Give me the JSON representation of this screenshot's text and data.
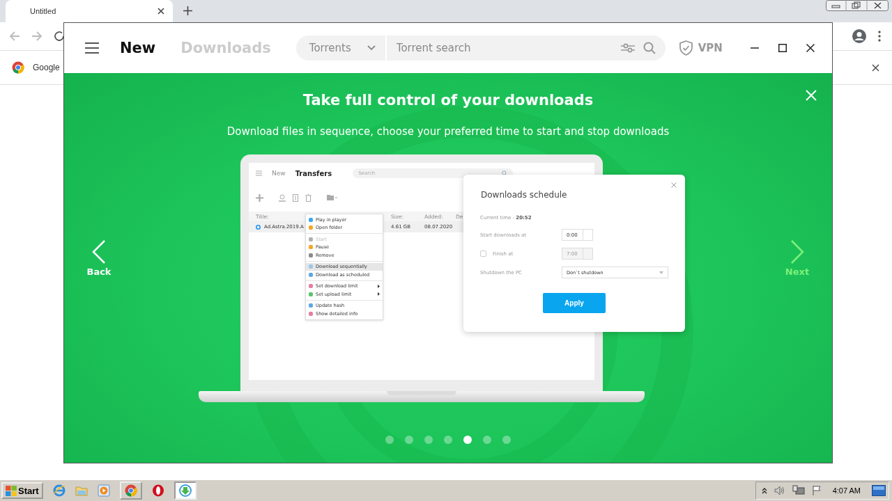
{
  "browser": {
    "tab_title": "Untitled",
    "bookmark": "Google"
  },
  "app": {
    "nav": [
      {
        "label": "New",
        "selected": true
      },
      {
        "label": "Downloads",
        "selected": false
      }
    ],
    "category": "Torrents",
    "search": {
      "placeholder": "Torrent search"
    },
    "vpn": "VPN"
  },
  "tour": {
    "title": "Take full control of your downloads",
    "subtitle": "Download files in sequence, choose your preferred time to start and stop downloads",
    "back": "Back",
    "next": "Next",
    "slides": [
      {
        "selected": false
      },
      {
        "selected": false
      },
      {
        "selected": false
      },
      {
        "selected": false
      },
      {
        "selected": true
      },
      {
        "selected": false
      },
      {
        "selected": false
      }
    ]
  },
  "preview": {
    "nav": [
      {
        "label": "New",
        "selected": false
      },
      {
        "label": "Transfers",
        "selected": true
      }
    ],
    "search": {
      "placeholder": "Search"
    },
    "columns": [
      "Title:",
      "Size:",
      "Added:",
      "De"
    ],
    "row": {
      "title": "Ad.Astra.2019.A",
      "size": "4.61 GB",
      "added": "08.07.2020"
    },
    "menu": [
      [
        {
          "label": "Play in player",
          "color": "#3ba7e8",
          "disabled": false,
          "selected": false,
          "submenu": false
        },
        {
          "label": "Open folder",
          "color": "#f5a623",
          "disabled": false,
          "selected": false,
          "submenu": false
        }
      ],
      [
        {
          "label": "Start",
          "color": "#b0b0b0",
          "disabled": true,
          "selected": false,
          "submenu": false
        },
        {
          "label": "Pause",
          "color": "#f5a623",
          "disabled": false,
          "selected": false,
          "submenu": false
        },
        {
          "label": "Remove",
          "color": "#8a8a8a",
          "disabled": false,
          "selected": false,
          "submenu": false
        }
      ],
      [
        {
          "label": "Download sequentially",
          "color": "#9cc7e8",
          "disabled": false,
          "selected": true,
          "submenu": false
        },
        {
          "label": "Download as scheduled",
          "color": "#5aa9e6",
          "disabled": false,
          "selected": false,
          "submenu": false
        }
      ],
      [
        {
          "label": "Set download limit",
          "color": "#e57ea0",
          "disabled": false,
          "selected": false,
          "submenu": true
        },
        {
          "label": "Set upload limit",
          "color": "#5cc46a",
          "disabled": false,
          "selected": false,
          "submenu": true
        }
      ],
      [
        {
          "label": "Update hash",
          "color": "#5aa9e6",
          "disabled": false,
          "selected": false,
          "submenu": false
        },
        {
          "label": "Show detailed info",
          "color": "#e57ea0",
          "disabled": false,
          "selected": false,
          "submenu": false
        }
      ]
    ]
  },
  "schedule": {
    "title": "Downloads schedule",
    "current_time": "Current time - **20:52**",
    "start_label": "Start downloads at",
    "start_value": "0:00",
    "finish": {
      "label": "Finish at",
      "checked": false,
      "value": "7:00"
    },
    "shutdown_label": "Shutdown the PC",
    "shutdown_value": "Don`t shutdown",
    "apply": "Apply"
  },
  "taskbar": {
    "start": "Start",
    "clock": "4:07 AM"
  }
}
